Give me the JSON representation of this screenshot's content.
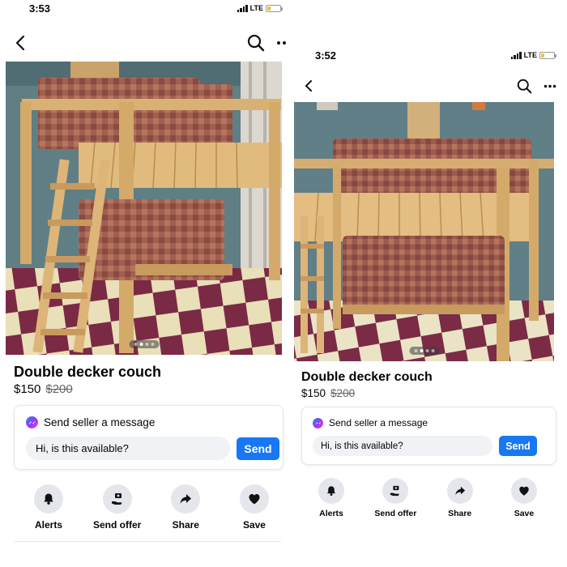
{
  "screenshots": [
    {
      "status": {
        "time": "3:53",
        "network": "LTE"
      },
      "listing": {
        "title": "Double decker couch",
        "price": "$150",
        "original_price": "$200"
      },
      "message": {
        "header": "Send seller a message",
        "input_value": "Hi, is this available?",
        "send_label": "Send"
      },
      "actions": [
        {
          "label": "Alerts",
          "icon": "bell-icon"
        },
        {
          "label": "Send offer",
          "icon": "send-offer-icon"
        },
        {
          "label": "Share",
          "icon": "share-icon"
        },
        {
          "label": "Save",
          "icon": "heart-icon"
        }
      ]
    },
    {
      "status": {
        "time": "3:52",
        "network": "LTE"
      },
      "listing": {
        "title": "Double decker couch",
        "price": "$150",
        "original_price": "$200"
      },
      "message": {
        "header": "Send seller a message",
        "input_value": "Hi, is this available?",
        "send_label": "Send"
      },
      "actions": [
        {
          "label": "Alerts",
          "icon": "bell-icon"
        },
        {
          "label": "Send offer",
          "icon": "send-offer-icon"
        },
        {
          "label": "Share",
          "icon": "share-icon"
        },
        {
          "label": "Save",
          "icon": "heart-icon"
        }
      ]
    }
  ],
  "colors": {
    "accent": "#1877f2",
    "battery": "#f2c12e",
    "icon_bg": "#e4e6eb"
  },
  "image_carousel": {
    "page_count": 4,
    "active_page": 2
  }
}
